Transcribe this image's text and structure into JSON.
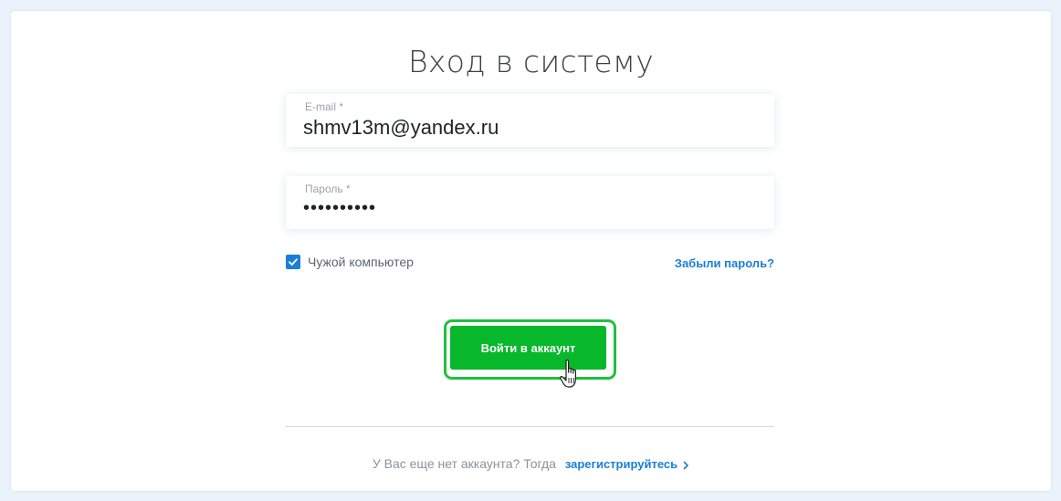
{
  "page": {
    "title": "Вход в систему"
  },
  "email": {
    "label": "E-mail *",
    "value": "shmv13m@yandex.ru"
  },
  "password": {
    "label": "Пароль *",
    "value": "••••••••••"
  },
  "remember": {
    "label": "Чужой компьютер",
    "checked": true
  },
  "forgot_link": "Забыли пароль?",
  "submit_label": "Войти в аккаунт",
  "footer": {
    "text": "У Вас еще нет аккаунта? Тогда",
    "register_link": "зарегистрируйтесь"
  },
  "icons": {
    "checkbox": "check-icon",
    "chevron": "chevron-right-icon",
    "cursor": "hand-pointer-icon"
  },
  "colors": {
    "accent_blue": "#1a7fd6",
    "button_green": "#06b82a",
    "button_outline": "#1fc03c",
    "page_bg": "#eaf3fb"
  }
}
